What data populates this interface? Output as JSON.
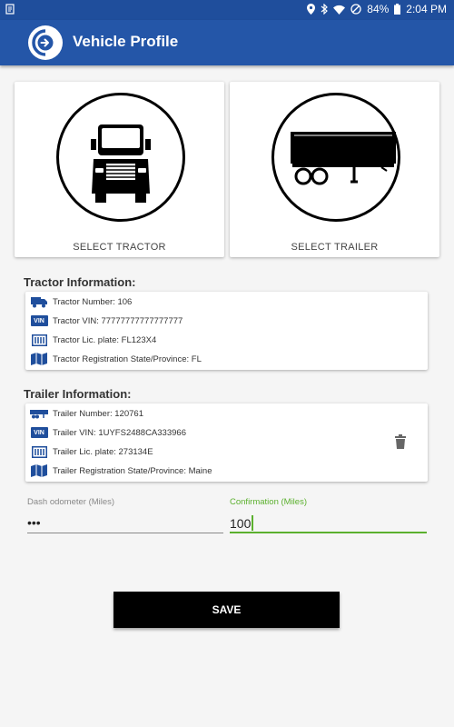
{
  "status_bar": {
    "battery": "84%",
    "time": "2:04 PM",
    "icons": [
      "notification-icon",
      "location-icon",
      "bluetooth-icon",
      "wifi-icon",
      "do-not-disturb-icon",
      "battery-icon"
    ]
  },
  "app_bar": {
    "title": "Vehicle Profile",
    "logo_icon": "arrow-circle-logo-icon"
  },
  "select_tractor": {
    "label": "SELECT TRACTOR",
    "icon": "semi-truck-front-icon"
  },
  "select_trailer": {
    "label": "SELECT TRAILER",
    "icon": "trailer-side-icon"
  },
  "tractor_info": {
    "title": "Tractor Information:",
    "rows": [
      {
        "icon": "truck-icon",
        "text": "Tractor Number: 106"
      },
      {
        "icon": "vin-icon",
        "text": "Tractor VIN: 77777777777777777"
      },
      {
        "icon": "license-plate-icon",
        "text": "Tractor Lic. plate: FL123X4"
      },
      {
        "icon": "map-icon",
        "text": "Tractor Registration State/Province: FL"
      }
    ]
  },
  "trailer_info": {
    "title": "Trailer Information:",
    "rows": [
      {
        "icon": "trailer-icon",
        "text": "Trailer Number: 120761"
      },
      {
        "icon": "vin-icon",
        "text": "Trailer VIN: 1UYFS2488CA333966"
      },
      {
        "icon": "license-plate-icon",
        "text": "Trailer Lic. plate: 273134E"
      },
      {
        "icon": "map-icon",
        "text": "Trailer Registration State/Province: Maine"
      }
    ],
    "delete_icon": "trash-icon"
  },
  "vin_badge": "VIN",
  "odometer": {
    "label": "Dash odometer (Miles)",
    "value": "•••"
  },
  "confirmation": {
    "label": "Confirmation (Miles)",
    "value": "100"
  },
  "save_button": {
    "label": "SAVE"
  },
  "colors": {
    "app_bar": "#2456a8",
    "status_bar": "#1f4e9c",
    "accent_green": "#5bb02e",
    "button": "#000000"
  }
}
